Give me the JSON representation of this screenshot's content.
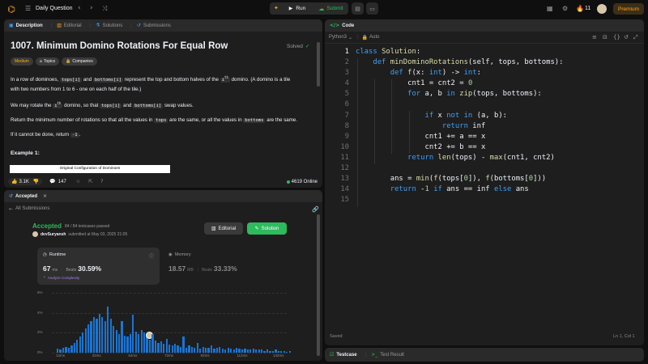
{
  "topbar": {
    "daily_question": "Daily Question",
    "run": "Run",
    "submit": "Submit",
    "streak": "11",
    "premium": "Premium"
  },
  "left_tabs": {
    "description": "Description",
    "editorial": "Editorial",
    "solutions": "Solutions",
    "submissions": "Submissions"
  },
  "problem": {
    "title": "1007. Minimum Domino Rotations For Equal Row",
    "status": "Solved",
    "difficulty": "Medium",
    "topics": "Topics",
    "companies": "Companies",
    "p1_a": "In a row of dominoes,",
    "p1_code1": "tops[i]",
    "p1_and": "and",
    "p1_code2": "bottoms[i]",
    "p1_b": "represent the top and bottom halves of the",
    "p1_sup": "i",
    "p1_th": "th",
    "p1_c": "domino. (A domino is a tile",
    "p1_d": "with two numbers from 1 to 6 - one on each half of the tile.)",
    "p2_a": "We may rotate the",
    "p2_sup": "i",
    "p2_th": "th",
    "p2_b": "domino, so that",
    "p2_code1": "tops[i]",
    "p2_and": "and",
    "p2_code2": "bottoms[i]",
    "p2_c": "swap values.",
    "p3_a": "Return the minimum number of rotations so that all the values in",
    "p3_code1": "tops",
    "p3_b": "are the same, or all the values in",
    "p3_code2": "bottoms",
    "p3_c": "are the same.",
    "p4_a": "If it cannot be done, return",
    "p4_code": "-1",
    "p4_b": ".",
    "example": "Example 1:",
    "figure_caption": "Original Configuration of Dominoes",
    "likes": "3.1K",
    "comments": "147",
    "online": "4619 Online"
  },
  "accepted_tab": "Accepted",
  "submission": {
    "all_submissions": "All Submissions",
    "status": "Accepted",
    "passed": "84 / 84 testcases passed",
    "user": "devSuryansh",
    "submitted": "submitted at May 03, 2025 21:05",
    "editorial": "Editorial",
    "solution": "Solution",
    "runtime_label": "Runtime",
    "runtime_value": "67",
    "runtime_unit": "ms",
    "beats": "Beats",
    "runtime_beats": "30.59%",
    "analyze": "Analyze Complexity",
    "memory_label": "Memory",
    "memory_value": "18.57",
    "memory_unit": "MB",
    "memory_beats": "33.33%"
  },
  "chart_data": {
    "type": "bar",
    "y_ticks": [
      "6%",
      "4%",
      "2%",
      "0%"
    ],
    "x_ticks": [
      "12ms",
      "32ms",
      "52ms",
      "72ms",
      "92ms",
      "112ms",
      "132ms"
    ],
    "ylim": [
      0,
      6
    ],
    "values": [
      0.4,
      0.3,
      0.5,
      0.6,
      0.5,
      0.7,
      1.0,
      1.3,
      1.6,
      2.0,
      2.4,
      2.8,
      3.2,
      3.6,
      3.4,
      3.9,
      3.6,
      3.2,
      4.6,
      3.4,
      2.7,
      2.3,
      1.9,
      3.2,
      1.7,
      1.6,
      1.9,
      3.8,
      2.1,
      1.9,
      2.3,
      2.0,
      1.6,
      1.3,
      1.9,
      1.2,
      1.0,
      1.1,
      0.9,
      1.4,
      0.8,
      0.7,
      0.9,
      0.7,
      0.6,
      1.6,
      0.5,
      0.7,
      0.6,
      0.5,
      1.0,
      0.4,
      0.6,
      0.5,
      0.5,
      0.7,
      0.4,
      0.5,
      0.6,
      0.4,
      0.3,
      0.5,
      0.4,
      0.3,
      0.5,
      0.4,
      0.3,
      0.4,
      0.3,
      0.3,
      0.4,
      0.3,
      0.3,
      0.3,
      0.2,
      0.3,
      0.2,
      0.2,
      0.3,
      0.2,
      0.2,
      0.2,
      0.1,
      0.2
    ],
    "highlight_index": 33,
    "bar_color": "#1a74d4"
  },
  "code_panel": {
    "title": "Code",
    "language": "Python3",
    "auto": "Auto",
    "saved": "Saved",
    "cursor": "Ln 1, Col 1",
    "testcase": "Testcase",
    "test_result": "Test Result"
  },
  "code_lines": [
    "class Solution:",
    "    def minDominoRotations(self, tops, bottoms):",
    "        def f(x: int) -> int:",
    "            cnt1 = cnt2 = 0",
    "            for a, b in zip(tops, bottoms):",
    "",
    "                if x not in (a, b):",
    "                    return inf",
    "                cnt1 += a == x",
    "                cnt2 += b == x",
    "            return len(tops) - max(cnt1, cnt2)",
    "",
    "        ans = min(f(tops[0]), f(bottoms[0]))",
    "        return -1 if ans == inf else ans",
    ""
  ],
  "colors": {
    "accent_green": "#2cbb5d",
    "accent_orange": "#ffa116",
    "keyword_blue": "#3c9ff8"
  }
}
